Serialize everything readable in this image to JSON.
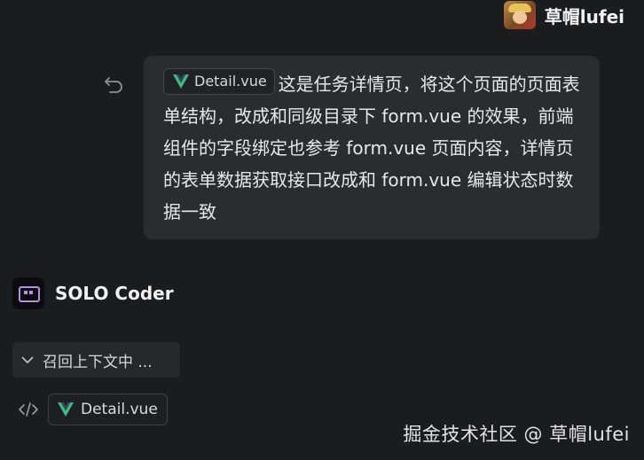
{
  "user": {
    "name": "草帽lufei"
  },
  "message": {
    "attachment": "Detail.vue",
    "text": "这是任务详情页，将这个页面的页面表单结构，改成和同级目录下 form.vue 的效果，前端组件的字段绑定也参考 form.vue 页面内容，详情页的表单数据获取接口改成和 form.vue 编辑状态时数据一致"
  },
  "agent": {
    "name": "SOLO Coder",
    "recall_label": "召回上下文中 ...",
    "file_chip": "Detail.vue"
  },
  "watermark": "掘金技术社区 @ 草帽lufei",
  "colors": {
    "background": "#1b1c1e",
    "bubble": "#2a2c30",
    "vue_green": "#42b883",
    "vue_dark": "#35495e",
    "agent_accent": "#b98ce8"
  },
  "icons": {
    "undo": "undo-icon",
    "vue": "vue-logo-icon",
    "chevron": "chevron-down-icon",
    "code": "code-icon"
  }
}
